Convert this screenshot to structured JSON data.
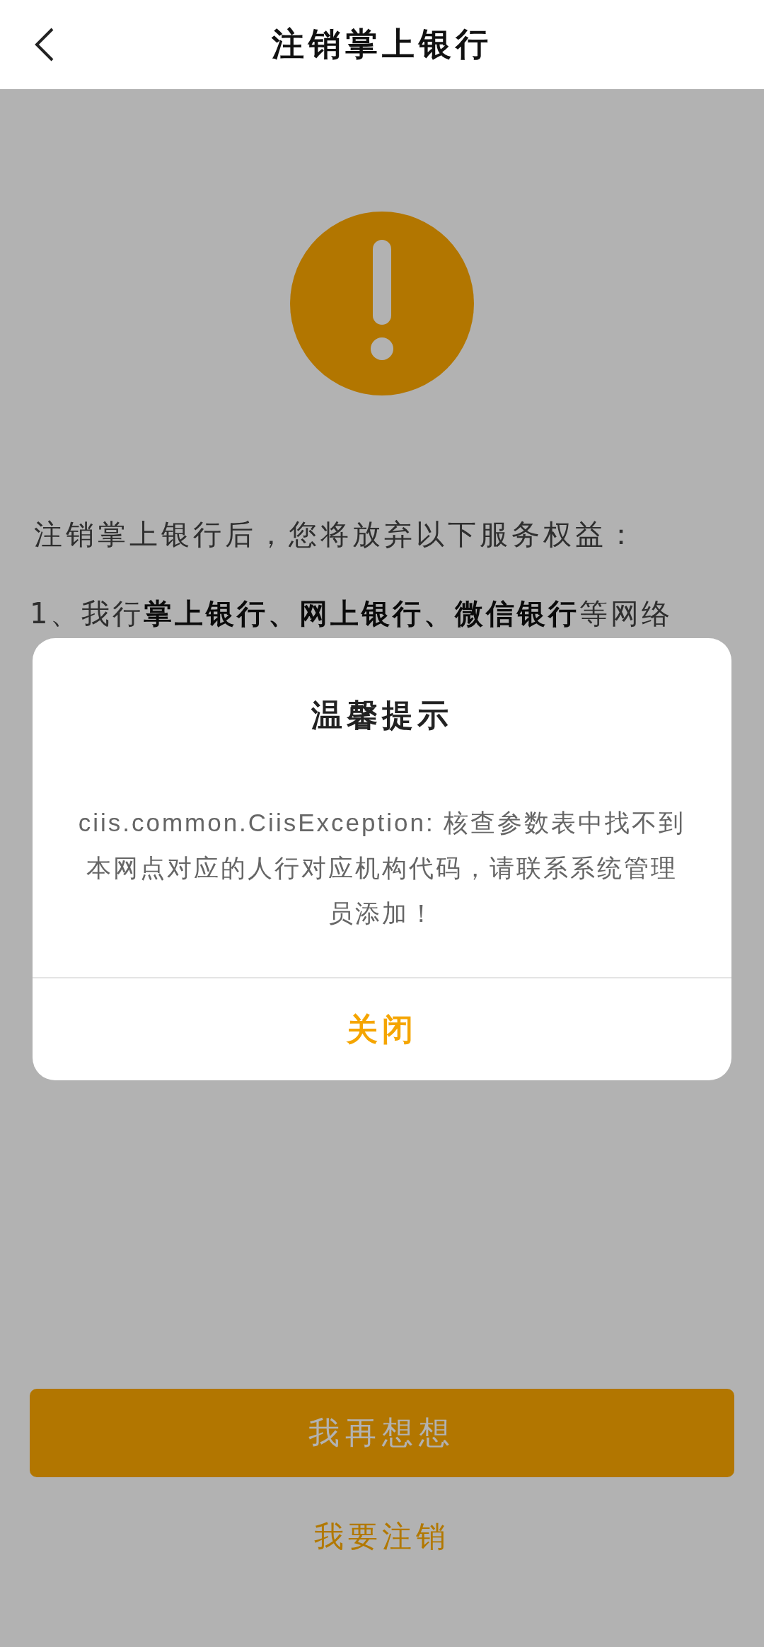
{
  "header": {
    "title": "注销掌上银行"
  },
  "notice": {
    "intro": "注销掌上银行后，您将放弃以下服务权益：",
    "items": [
      "1、我行**掌上银行、网上银行、微信银行**等网络"
    ]
  },
  "buttons": [
    {
      "label": "我再想想",
      "kind": "primary"
    },
    {
      "label": "我要注销",
      "kind": "link"
    }
  ],
  "dialog": {
    "title": "温馨提示",
    "message": "ciis.common.CiisException: 核查参数表中找不到本网点对应的人行对应机构代码，请联系系统管理员添加！",
    "buttons": [
      "关闭"
    ]
  }
}
